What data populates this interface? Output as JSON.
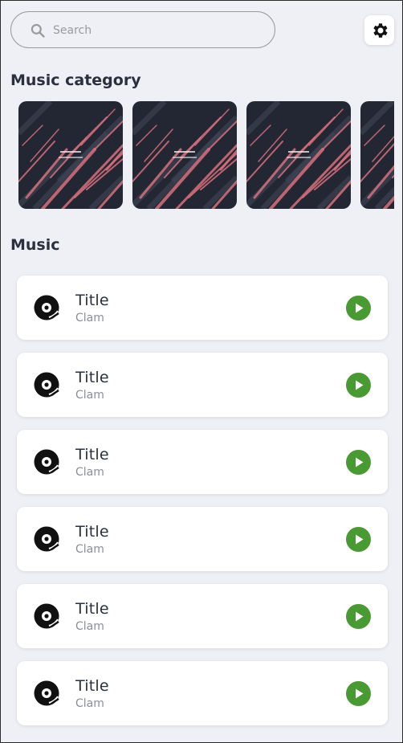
{
  "search": {
    "placeholder": "Search"
  },
  "sections": {
    "category_title": "Music category",
    "music_title": "Music"
  },
  "categories": [
    {
      "name": "category-card-1"
    },
    {
      "name": "category-card-2"
    },
    {
      "name": "category-card-3"
    },
    {
      "name": "category-card-4"
    }
  ],
  "songs": [
    {
      "title": "Title",
      "artist": "Clam"
    },
    {
      "title": "Title",
      "artist": "Clam"
    },
    {
      "title": "Title",
      "artist": "Clam"
    },
    {
      "title": "Title",
      "artist": "Clam"
    },
    {
      "title": "Title",
      "artist": "Clam"
    },
    {
      "title": "Title",
      "artist": "Clam"
    }
  ],
  "colors": {
    "background": "#eef0f6",
    "play_green": "#4a9a34",
    "text_dark": "#2b2f3e",
    "text_muted": "#8a8f9c",
    "cover_dark": "#232733",
    "cover_accent": "#d9707d"
  },
  "icons": {
    "search": "search-icon",
    "settings": "gear-icon",
    "disc": "vinyl-disc-icon",
    "play": "play-icon"
  }
}
